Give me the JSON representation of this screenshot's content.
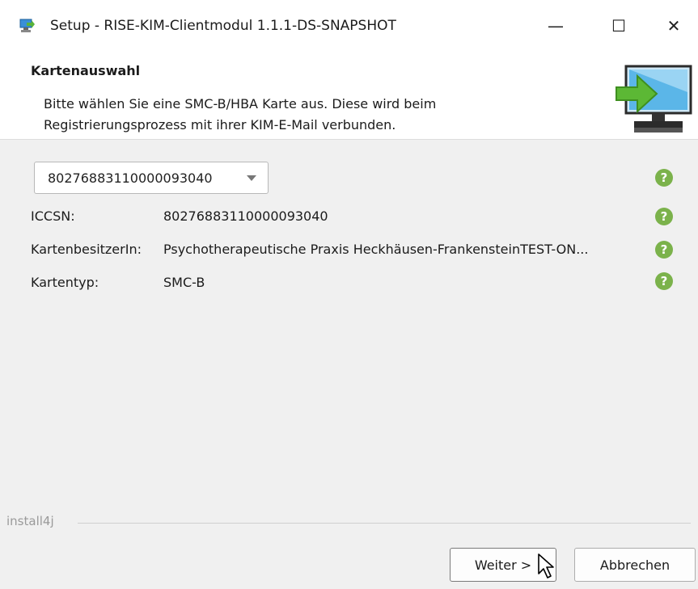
{
  "window": {
    "title": "Setup - RISE-KIM-Clientmodul 1.1.1-DS-SNAPSHOT",
    "minimize_glyph": "—",
    "maximize_glyph": "☐",
    "close_glyph": "✕"
  },
  "header": {
    "title": "Kartenauswahl",
    "description": "Bitte wählen Sie eine SMC-B/HBA Karte aus. Diese wird beim Registrierungsprozess mit ihrer KIM-E-Mail verbunden.",
    "icon": "computer-arrow-icon"
  },
  "card_select": {
    "value": "80276883110000093040"
  },
  "details": [
    {
      "label": "ICCSN:",
      "value": "80276883110000093040"
    },
    {
      "label": "KartenbesitzerIn:",
      "value": "Psychotherapeutische Praxis Heckhäusen-FrankensteinTEST-ON..."
    },
    {
      "label": "Kartentyp:",
      "value": "SMC-B"
    }
  ],
  "help_glyph": "?",
  "footer": {
    "brand": "install4j",
    "next_label": "Weiter >",
    "cancel_label": "Abbrechen"
  },
  "colors": {
    "help_icon": "#7bb24b",
    "header_bg": "#ffffff",
    "body_bg": "#f0f0f0"
  }
}
